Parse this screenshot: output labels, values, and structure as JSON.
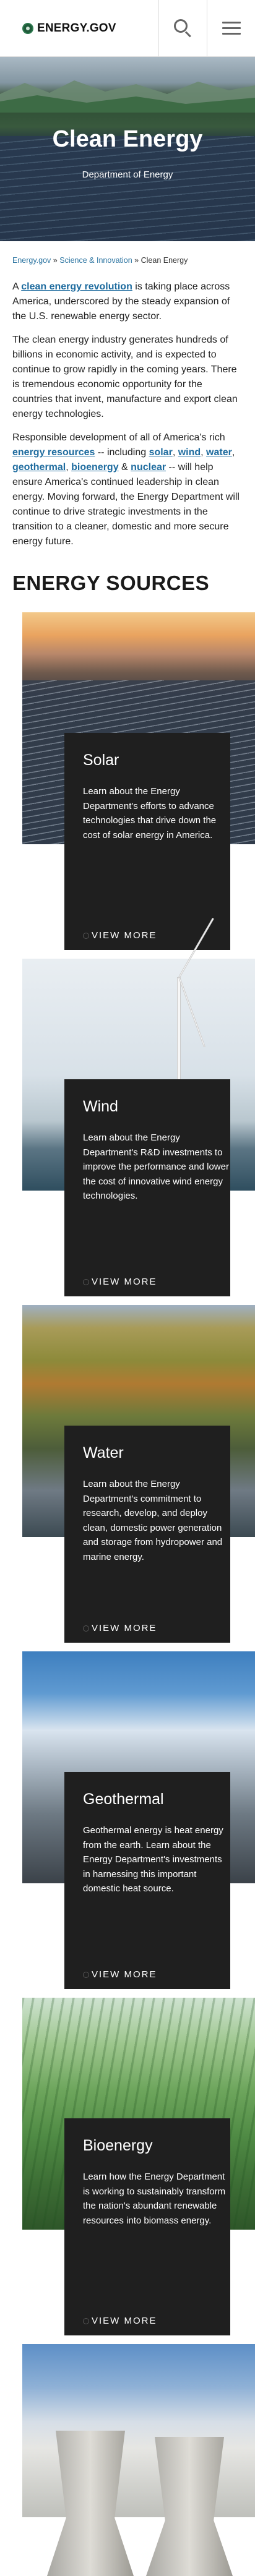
{
  "header": {
    "logo_text": "ENERGY.GOV",
    "search_icon": "search-icon",
    "menu_icon": "hamburger-menu-icon"
  },
  "hero": {
    "title": "Clean Energy",
    "subtitle": "Department of Energy"
  },
  "breadcrumb": {
    "items": [
      "Energy.gov",
      "Science & Innovation",
      "Clean Energy"
    ],
    "separator": "»"
  },
  "intro": {
    "p1_pre": "A ",
    "p1_link": "clean energy revolution",
    "p1_post": " is taking place across America, underscored by the steady expansion of the U.S. renewable energy sector.",
    "p2": "The clean energy industry generates hundreds of billions in economic activity, and is expected to continue to grow rapidly in the coming years. There is tremendous economic opportunity for the countries that invent, manufacture and export clean energy technologies.",
    "p3_pre": "Responsible development of all of America's rich ",
    "p3_link_resources": "energy resources",
    "p3_mid1": " -- including ",
    "p3_link_solar": "solar",
    "p3_comma1": ", ",
    "p3_link_wind": "wind",
    "p3_comma2": ", ",
    "p3_link_water": "water",
    "p3_comma3": ", ",
    "p3_link_geothermal": "geothermal",
    "p3_comma4": ", ",
    "p3_link_bioenergy": "bioenergy",
    "p3_amp": " & ",
    "p3_link_nuclear": "nuclear",
    "p3_post": " -- will help ensure America's continued leadership in clean energy. Moving forward, the Energy Department will continue to drive strategic investments in the transition to a cleaner, domestic and more secure energy future."
  },
  "section_title": "ENERGY SOURCES",
  "cards": [
    {
      "title": "Solar",
      "desc": "Learn about the Energy Department's efforts to advance technologies that drive down the cost of solar energy in America.",
      "more": "VIEW MORE"
    },
    {
      "title": "Wind",
      "desc": "Learn about the Energy Department's R&D investments to improve the performance and lower the cost of innovative wind energy technologies.",
      "more": "VIEW MORE"
    },
    {
      "title": "Water",
      "desc": "Learn about the Energy Department's commitment to research, develop, and deploy clean, domestic power generation and storage from hydropower and marine energy.",
      "more": "VIEW MORE"
    },
    {
      "title": "Geothermal",
      "desc": "Geothermal energy is heat energy from the earth. Learn about the Energy Department's investments in harnessing this important domestic heat source.",
      "more": "VIEW MORE"
    },
    {
      "title": "Bioenergy",
      "desc": "Learn how the Energy Department is working to sustainably transform the nation's abundant renewable resources into biomass energy.",
      "more": "VIEW MORE"
    }
  ]
}
